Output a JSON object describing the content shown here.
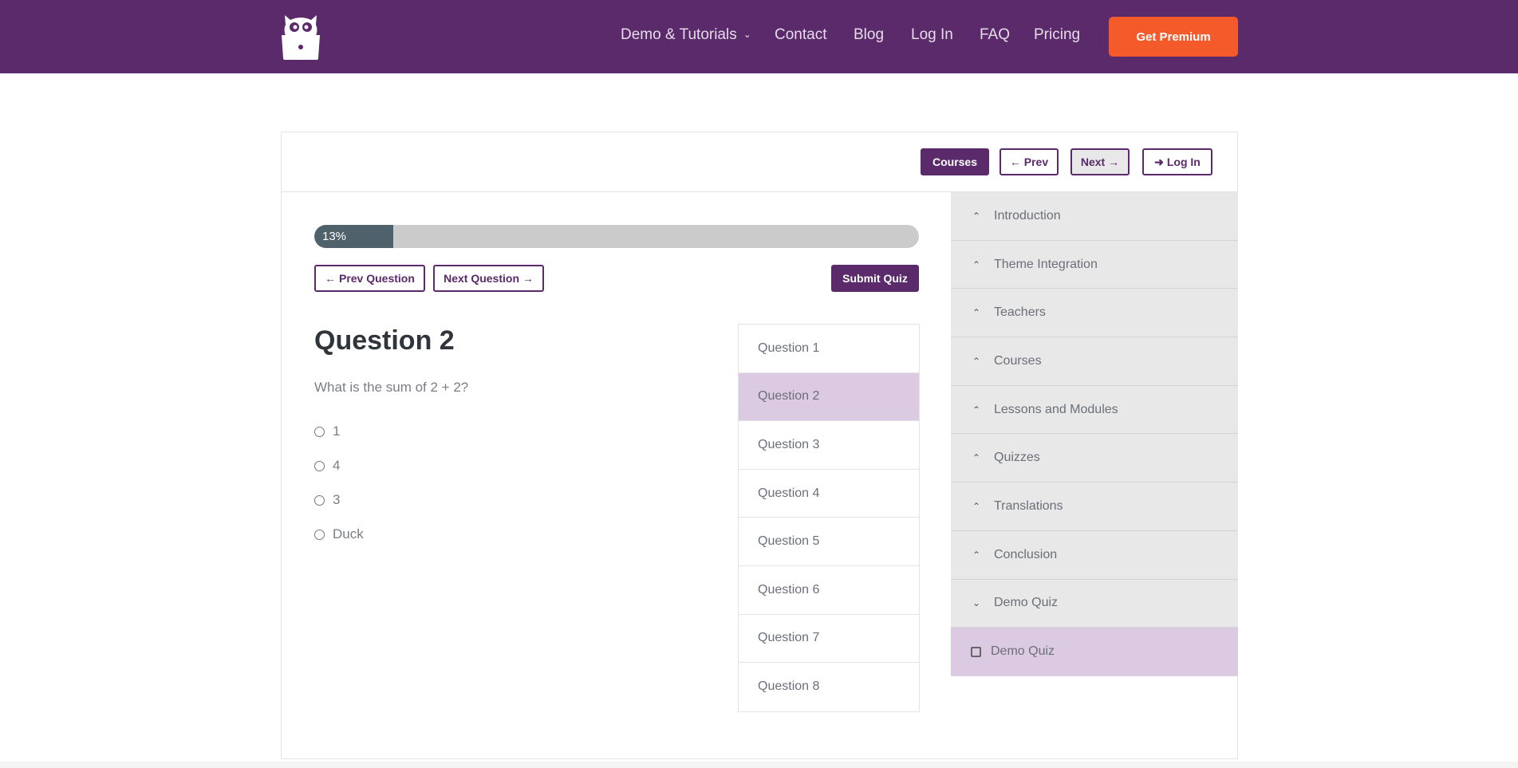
{
  "header": {
    "logo": "owl-laptop-logo",
    "nav": [
      {
        "label": "Demo & Tutorials",
        "has_dropdown": true
      },
      {
        "label": "Contact"
      },
      {
        "label": "Blog"
      },
      {
        "label": "Log In"
      },
      {
        "label": "FAQ"
      },
      {
        "label": "Pricing"
      }
    ],
    "cta_label": "Get Premium"
  },
  "toolbar": {
    "courses_label": "Courses",
    "prev_label": "← Prev",
    "next_label": "Next →",
    "login_label": "Log In",
    "login_icon": "sign-in-icon"
  },
  "quiz": {
    "progress_percent": 13,
    "progress_label": "13%",
    "prev_question_label": "← Prev Question",
    "next_question_label": "Next Question →",
    "submit_label": "Submit Quiz",
    "question_title": "Question 2",
    "question_text": "What is the sum of 2 + 2?",
    "options": [
      "1",
      "4",
      "3",
      "Duck"
    ],
    "question_list": [
      "Question 1",
      "Question 2",
      "Question 3",
      "Question 4",
      "Question 5",
      "Question 6",
      "Question 7",
      "Question 8"
    ],
    "active_question_index": 1
  },
  "sidebar": {
    "sections": [
      {
        "label": "Introduction",
        "state": "collapsed"
      },
      {
        "label": "Theme Integration",
        "state": "collapsed"
      },
      {
        "label": "Teachers",
        "state": "collapsed"
      },
      {
        "label": "Courses",
        "state": "collapsed"
      },
      {
        "label": "Lessons and Modules",
        "state": "collapsed"
      },
      {
        "label": "Quizzes",
        "state": "collapsed"
      },
      {
        "label": "Translations",
        "state": "collapsed"
      },
      {
        "label": "Conclusion",
        "state": "collapsed"
      },
      {
        "label": "Demo Quiz",
        "state": "expanded"
      }
    ],
    "sub_items": [
      {
        "label": "Demo Quiz",
        "active": true
      }
    ]
  },
  "colors": {
    "brand_purple": "#5a2a6a",
    "cta_orange": "#f55b2a",
    "active_highlight": "#dccae2",
    "progress_fill": "#4f616b"
  }
}
